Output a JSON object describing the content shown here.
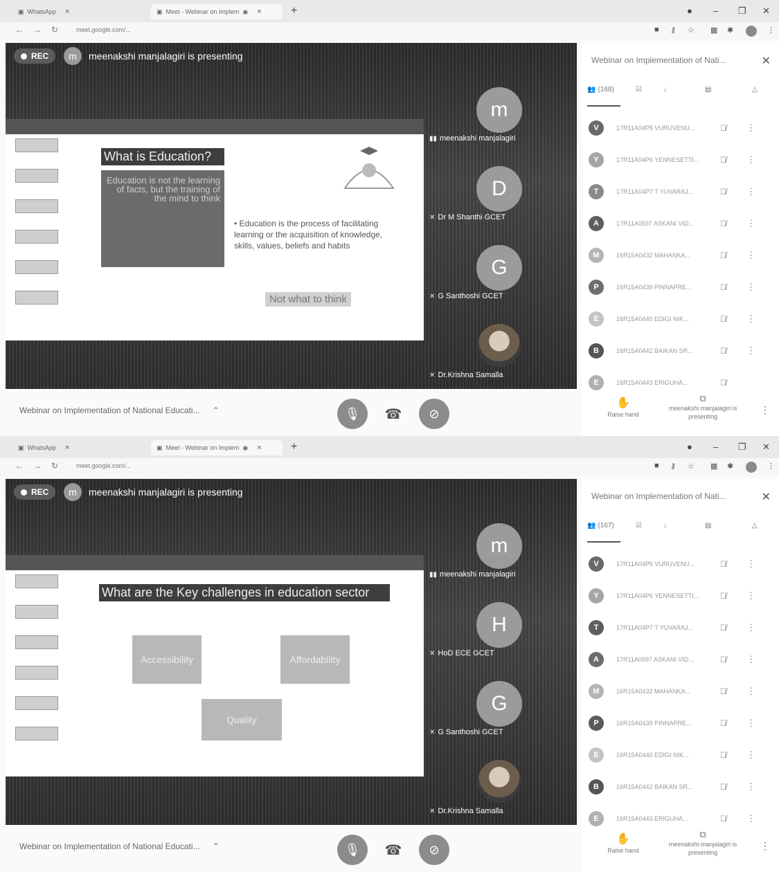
{
  "screens": [
    {
      "browser": {
        "tab_a_label": "WhatsApp",
        "tab_b_label": "Meet - Webinar on Implem",
        "url": "meet.google.com/..."
      },
      "rec_label": "REC",
      "presenter": {
        "avatar_letter": "m",
        "text": "meenakshi manjalagiri is presenting"
      },
      "slide": {
        "title": "What is Education?",
        "box_text": "Education is not the learning of facts, but the training of the mind to think",
        "bullet": "• Education is the process of facilitating learning or the acquisition of knowledge, skills, values, beliefs and habits",
        "tag": "Not what to think"
      },
      "tiles": [
        {
          "letter": "m",
          "name": "meenakshi manjalagiri"
        },
        {
          "letter": "D",
          "name": "Dr M Shanthi GCET"
        },
        {
          "letter": "G",
          "name": "G Santhoshi GCET"
        },
        {
          "letter": "",
          "name": "Dr.Krishna Samalla"
        }
      ],
      "bottom": {
        "meeting_name": "Webinar on Implementation of National Educati..."
      },
      "panel": {
        "title": "Webinar on Implementation of Nati...",
        "people_count": "(168)",
        "participants": [
          {
            "letter": "V",
            "name": "17R11A04P5 VURUVENU...",
            "color": "#6a6a6a"
          },
          {
            "letter": "Y",
            "name": "17R11A04P6 YENNESETTI...",
            "color": "#a5a5a5"
          },
          {
            "letter": "T",
            "name": "17R11A04P7 T YUVARAJ...",
            "color": "#8a8a8a"
          },
          {
            "letter": "A",
            "name": "17R11A0597 ASKANI VID...",
            "color": "#5e5e5e"
          },
          {
            "letter": "M",
            "name": "16R15A0432 MAHANKA...",
            "color": "#b5b5b5"
          },
          {
            "letter": "P",
            "name": "16R15A0439 PINNAPRE...",
            "color": "#6e6e6e"
          },
          {
            "letter": "E",
            "name": "16R15A0440 EDIGI NIK...",
            "color": "#c4c4c4"
          },
          {
            "letter": "B",
            "name": "16R15A0442 BAIKAN SR...",
            "color": "#555555"
          },
          {
            "letter": "E",
            "name": "16R15A0443 ERIGUHA...",
            "color": "#b0b0b0"
          }
        ],
        "raise_hand": "Raise hand",
        "presenting": "meenakshi manjalagiri is presenting"
      }
    },
    {
      "browser": {
        "tab_a_label": "WhatsApp",
        "tab_b_label": "Meet - Webinar on Implem",
        "url": "meet.google.com/..."
      },
      "rec_label": "REC",
      "presenter": {
        "avatar_letter": "m",
        "text": "meenakshi manjalagiri is presenting"
      },
      "slide": {
        "title": "What are the Key challenges in education sector",
        "items": [
          "Accessibility",
          "Affordability",
          "Quality"
        ]
      },
      "tiles": [
        {
          "letter": "m",
          "name": "meenakshi manjalagiri"
        },
        {
          "letter": "H",
          "name": "HoD ECE GCET"
        },
        {
          "letter": "G",
          "name": "G Santhoshi GCET"
        },
        {
          "letter": "",
          "name": "Dr.Krishna Samalla"
        }
      ],
      "bottom": {
        "meeting_name": "Webinar on Implementation of National Educati..."
      },
      "panel": {
        "title": "Webinar on Implementation of Nati...",
        "people_count": "(167)",
        "participants": [
          {
            "letter": "V",
            "name": "17R11A04P5 VURUVENU...",
            "color": "#6a6a6a"
          },
          {
            "letter": "Y",
            "name": "17R11A04P6 YENNESETTI...",
            "color": "#a5a5a5"
          },
          {
            "letter": "T",
            "name": "17R11A04P7 T YUVARAJ...",
            "color": "#5e5e5e"
          },
          {
            "letter": "A",
            "name": "17R11A0597 ASKANI VID...",
            "color": "#6e6e6e"
          },
          {
            "letter": "M",
            "name": "16R15A0432 MAHANKA...",
            "color": "#b5b5b5"
          },
          {
            "letter": "P",
            "name": "16R15A0439 PINNAPRE...",
            "color": "#5a5a5a"
          },
          {
            "letter": "E",
            "name": "16R15A0440 EDIGI NIK...",
            "color": "#c4c4c4"
          },
          {
            "letter": "B",
            "name": "16R15A0442 BAIKAN SR...",
            "color": "#555555"
          },
          {
            "letter": "E",
            "name": "16R15A0443 ERIGUHA...",
            "color": "#b0b0b0"
          }
        ],
        "raise_hand": "Raise hand",
        "presenting": "meenakshi manjalagiri is presenting"
      }
    }
  ]
}
